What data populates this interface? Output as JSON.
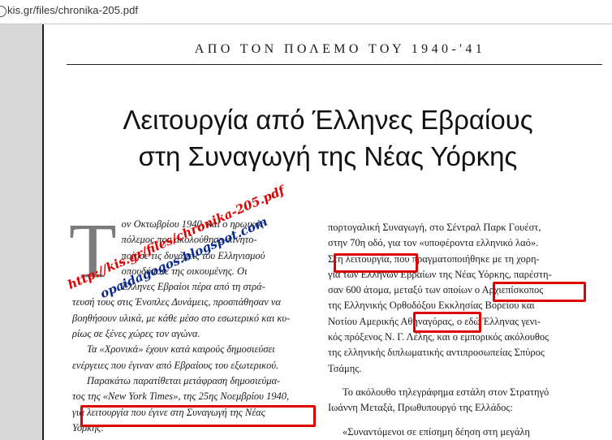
{
  "browser": {
    "url": "kis.gr/files/chronika-205.pdf"
  },
  "pdf": {
    "running_head": "ΑΠΟ ΤΟΝ ΠΟΛΕΜΟ ΤΟΥ 1940-'41",
    "title_line1": "Λειτουργία από Έλληνες Εβραίους",
    "title_line2": "στη Συναγωγή της Νέας Υόρκης",
    "dropcap": "Τ",
    "left_column": {
      "p1_lines": [
        "ον Οκτωβρίου 1940, και ο ηρωικός",
        "πόλεμος που ακολούθησε, κινητο-",
        "ποίησε τις δυνάμεις του Ελληνισμού",
        "οπουδήποτε της οικουμένης. Οι",
        "Έλληνες Εβραίοι πέρα από τη στρά-",
        "τευσή τους στις Ένοπλες Δυνάμεις, προσπάθησαν να",
        "βοηθήσουν υλικά, με κάθε μέσο στο εσωτερικό και κυ-",
        "ρίως σε ξένες χώρες τον αγώνα."
      ],
      "p2_lines": [
        "Τα «Χρονικά» έχουν κατά καιρούς δημοσιεύσει",
        "ενέργειες που έγιναν από Εβραίους του εξωτερικού."
      ],
      "p3_lines": [
        "Παρακάτω παρατίθεται μετάφραση δημοσιεύμα-",
        "τος της «New York Times», της 25ης Νοεμβρίου 1940,",
        "για λειτουργία που έγινε στη Συναγωγή της Νέας",
        "Υόρκης:"
      ]
    },
    "right_column": {
      "p1_lines": [
        "πορτογαλική Συναγωγή, στο Σέντραλ Παρκ Γουέστ,",
        "στην 70η οδό, για τον «υποφέροντα ελληνικό λαό».",
        "Στη λειτουργία, που πραγματοποιήθηκε με τη χορη-",
        "γία των Ελλήνων Εβραίων της Νέας Υόρκης, παρέστη-",
        "σαν 600 άτομα, μεταξύ των οποίων ο Αρχιεπίσκοπος",
        "της Ελληνικής Ορθοδόξου Εκκλησίας Βορείου και",
        "Νοτίου Αμερικής Αθηναγόρας, ο εδώ Έλληνας γενι-",
        "κός πρόξενος Ν. Γ. Λέλης, και ο εμπορικός ακόλουθος",
        "της ελληνικής διπλωματικής αντιπροσωπείας Σπύρος",
        "Τσάμης."
      ],
      "p2_lines": [
        "Το ακόλουθο τηλεγράφημα εστάλη στον Στρατηγό",
        "Ιωάννη Μεταξά, Πρωθυπουργό της Ελλάδος:"
      ],
      "p3_lines": [
        "«Συναντόμενοι σε επίσημη δέηση στη μεγάλη"
      ]
    },
    "watermark_line1": "http://kis.gr/files/chronika-205.pdf",
    "watermark_line2": "opaidagogos.blogspot.com"
  },
  "colors": {
    "highlight": "#e00000",
    "watermark_red": "#e00000",
    "watermark_blue": "#0a2a8f"
  }
}
